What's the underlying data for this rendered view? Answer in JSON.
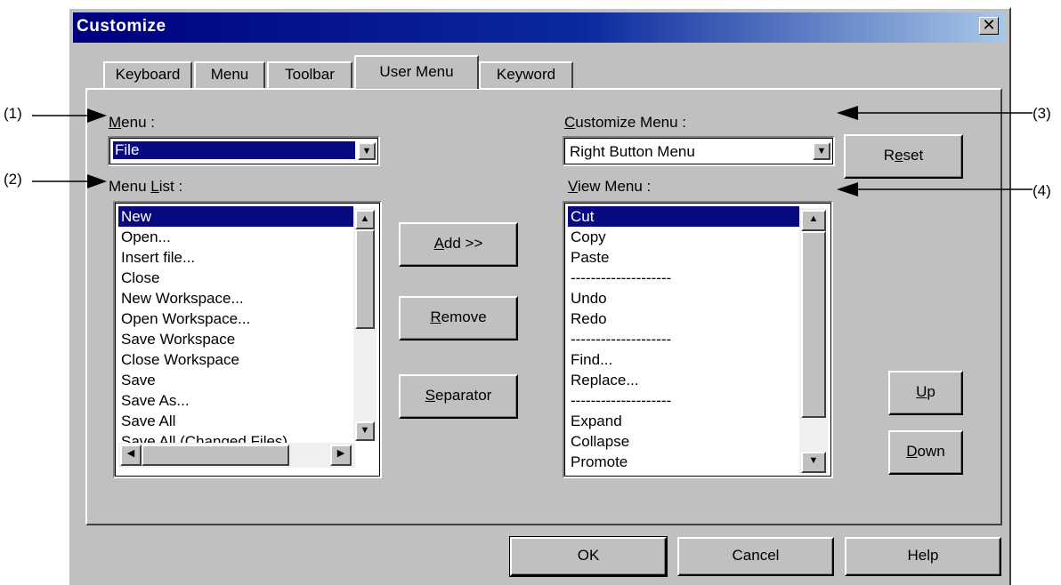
{
  "window": {
    "title": "Customize",
    "close_glyph": "✕"
  },
  "tabs": [
    {
      "label": "Keyboard",
      "active": false
    },
    {
      "label": "Menu",
      "active": false
    },
    {
      "label": "Toolbar",
      "active": false
    },
    {
      "label": "User Menu",
      "active": true
    },
    {
      "label": "Keyword",
      "active": false
    }
  ],
  "left": {
    "menu_label_u": "M",
    "menu_label_rest": "enu :",
    "menu_value": "File",
    "list_label_pre": "Menu ",
    "list_label_u": "L",
    "list_label_rest": "ist :",
    "list_items": [
      "New",
      "Open...",
      "Insert file...",
      "Close",
      "New Workspace...",
      "Open Workspace...",
      "Save Workspace",
      "Close Workspace",
      "Save",
      "Save As...",
      "Save All",
      "Save All (Changed Files)"
    ]
  },
  "middle": {
    "add_u": "A",
    "add_rest": "dd >>",
    "remove_u": "R",
    "remove_rest": "emove",
    "separator_u": "S",
    "separator_rest": "eparator"
  },
  "right": {
    "customize_label_u": "C",
    "customize_label_rest": "ustomize Menu :",
    "customize_value": "Right Button Menu",
    "reset_pre": "R",
    "reset_u": "e",
    "reset_rest": "set",
    "view_label_u": "V",
    "view_label_rest": "iew Menu :",
    "view_items": [
      "Cut",
      "Copy",
      "Paste",
      "--------------------",
      "Undo",
      "Redo",
      "--------------------",
      "Find...",
      "Replace...",
      "--------------------",
      "Expand",
      "Collapse",
      "Promote"
    ],
    "up_u": "U",
    "up_rest": "p",
    "down_u": "D",
    "down_rest": "own"
  },
  "footer": {
    "ok": "OK",
    "cancel": "Cancel",
    "help": "Help"
  },
  "callouts": {
    "c1": "(1)",
    "c2": "(2)",
    "c3": "(3)",
    "c4": "(4)"
  },
  "icons": {
    "dropdown": "down-arrow",
    "scroll_up": "up-arrow",
    "scroll_down": "down-arrow",
    "scroll_left": "left-arrow",
    "scroll_right": "right-arrow"
  }
}
